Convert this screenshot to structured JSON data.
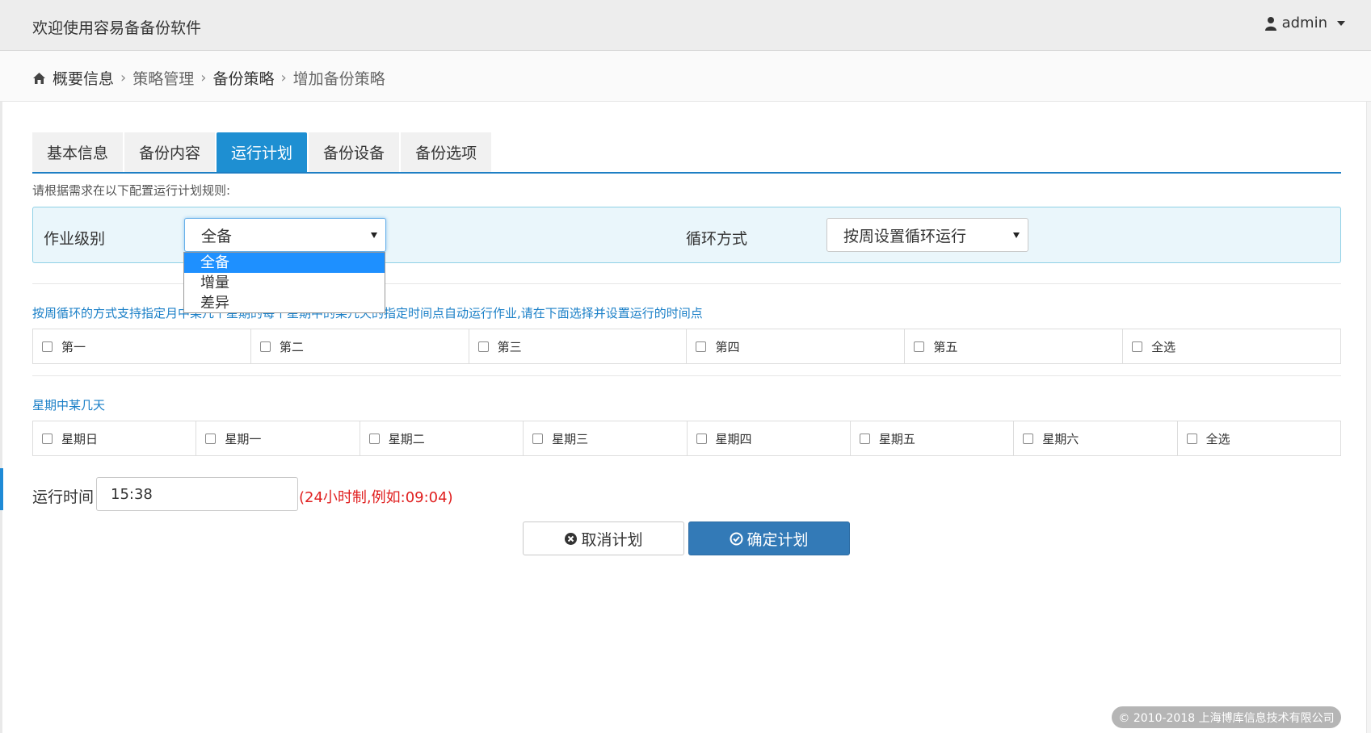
{
  "header": {
    "app_title": "欢迎使用容易备备份软件",
    "user": "admin"
  },
  "breadcrumb": {
    "items": [
      "概要信息",
      "策略管理",
      "备份策略",
      "增加备份策略"
    ]
  },
  "tabs": [
    {
      "label": "基本信息"
    },
    {
      "label": "备份内容"
    },
    {
      "label": "运行计划"
    },
    {
      "label": "备份设备"
    },
    {
      "label": "备份选项"
    }
  ],
  "active_tab": "运行计划",
  "hint": "请根据需求在以下配置运行计划规则:",
  "config": {
    "job_level_label": "作业级别",
    "job_level_value": "全备",
    "job_level_options": [
      "全备",
      "增量",
      "差异"
    ],
    "cycle_label": "循环方式",
    "cycle_value": "按周设置循环运行"
  },
  "weekly_section": {
    "title": "按周循环的方式支持指定月中某几个星期的每个星期中的某几天的指定时间点自动运行作业,请在下面选择并设置运行的时间点",
    "weeks": [
      "第一",
      "第二",
      "第三",
      "第四",
      "第五",
      "全选"
    ]
  },
  "days_section": {
    "title": "星期中某几天",
    "days": [
      "星期日",
      "星期一",
      "星期二",
      "星期三",
      "星期四",
      "星期五",
      "星期六",
      "全选"
    ]
  },
  "run_time": {
    "label": "运行时间",
    "value": "15:38",
    "hint": "(24小时制,例如:09:04)"
  },
  "buttons": {
    "cancel": "取消计划",
    "confirm": "确定计划"
  },
  "footer": "© 2010-2018 上海博库信息技术有限公司",
  "colors": {
    "accent": "#1e8fd2",
    "primary_button": "#337ab7",
    "link_text": "#1a7fc7",
    "error_text": "#e02020",
    "selected_option": "#1e90ff"
  }
}
